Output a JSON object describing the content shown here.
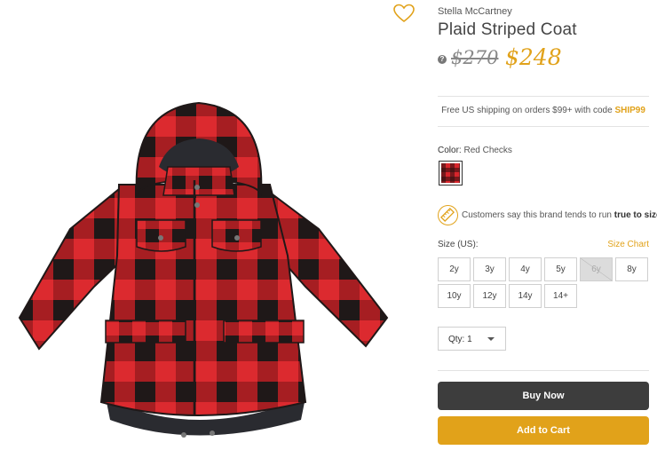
{
  "product": {
    "brand": "Stella McCartney",
    "title": "Plaid Striped Coat",
    "old_price": "$270",
    "new_price": "$248",
    "image_icon": "plaid-coat-image",
    "favorite_icon": "heart-icon"
  },
  "shipping": {
    "text": "Free US shipping on orders $99+ with code ",
    "code": "SHIP99"
  },
  "color": {
    "label": "Color:",
    "value": "Red Checks",
    "swatch_colors": [
      "#d8252c",
      "#2a1414"
    ]
  },
  "fit": {
    "text_before": "Customers say this brand tends to run ",
    "text_bold": "true to size",
    "text_after": "."
  },
  "size": {
    "label": "Size (US):",
    "chart_link": "Size Chart",
    "options": [
      {
        "label": "2y",
        "available": true
      },
      {
        "label": "3y",
        "available": true
      },
      {
        "label": "4y",
        "available": true
      },
      {
        "label": "5y",
        "available": true
      },
      {
        "label": "6y",
        "available": false
      },
      {
        "label": "8y",
        "available": true
      },
      {
        "label": "10y",
        "available": true
      },
      {
        "label": "12y",
        "available": true
      },
      {
        "label": "14y",
        "available": true
      },
      {
        "label": "14+",
        "available": true
      }
    ]
  },
  "quantity": {
    "label": "Qty: 1"
  },
  "actions": {
    "buy_now": "Buy Now",
    "add_to_cart": "Add to Cart"
  },
  "colors": {
    "accent": "#e1a21a",
    "dark_button": "#3d3d3d",
    "plaid_red": "#d8252c",
    "plaid_black": "#231a1a"
  }
}
